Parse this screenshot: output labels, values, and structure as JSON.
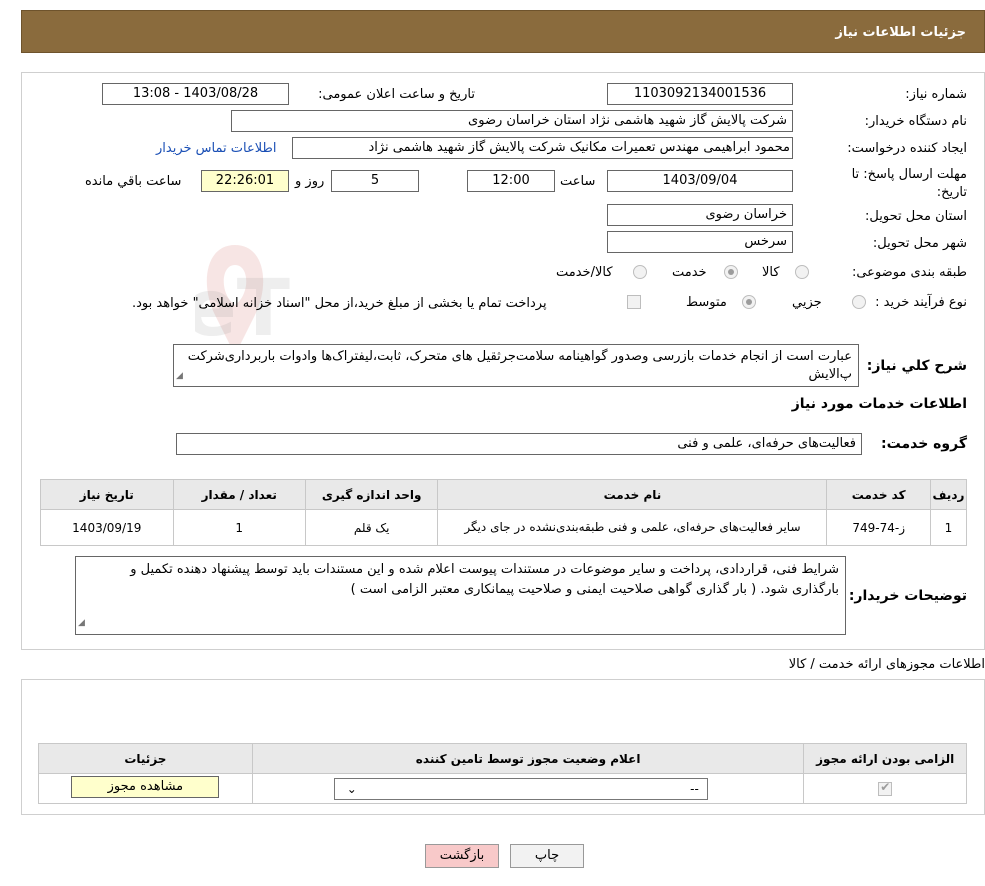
{
  "header": {
    "title": "جزئیات اطلاعات نیاز"
  },
  "form": {
    "need_number": {
      "label": "شماره نیاز:",
      "value": "1103092134001536"
    },
    "announce_datetime": {
      "label": "تاریخ و ساعت اعلان عمومی:",
      "value": "1403/08/28 - 13:08"
    },
    "buyer_org": {
      "label": "نام دستگاه خریدار:",
      "value": "شرکت پالایش گاز شهید هاشمی نژاد   استان خراسان رضوی"
    },
    "requester": {
      "label": "ایجاد کننده درخواست:",
      "value": "محمود ابراهیمی مهندس تعمیرات مکانیک شرکت پالایش گاز شهید هاشمی نژاد",
      "contact_link": "اطلاعات تماس خریدار"
    },
    "deadline": {
      "label": "مهلت ارسال پاسخ: تا تاریخ:",
      "date": "1403/09/04",
      "time_label": "ساعت",
      "time": "12:00",
      "days": "5",
      "days_label": "روز و",
      "remaining": "22:26:01",
      "remaining_label": "ساعت باقي مانده"
    },
    "delivery_province": {
      "label": "استان محل تحویل:",
      "value": "خراسان رضوی"
    },
    "delivery_city": {
      "label": "شهر محل تحویل:",
      "value": "سرخس"
    },
    "category": {
      "label": "طبقه بندی موضوعی:",
      "options": [
        {
          "label": "کالا",
          "checked": false
        },
        {
          "label": "خدمت",
          "checked": true
        },
        {
          "label": "کالا/خدمت",
          "checked": false
        }
      ]
    },
    "purchase_type": {
      "label": "نوع فرآیند خرید :",
      "options": [
        {
          "label": "جزیي",
          "checked": false
        },
        {
          "label": "متوسط",
          "checked": true
        }
      ],
      "note": "پرداخت تمام یا بخشی از مبلغ خرید،از محل \"اسناد خزانه اسلامی\" خواهد بود."
    },
    "description": {
      "label": "شرح کلي نياز:",
      "value": "عبارت است از انجام خدمات بازرسی وصدور گواهینامه سلامت‌جرثقیل های متحرک، ثابت،لیفتراک‌ها وادوات باربرداری‌شرکت پ‌الایش"
    }
  },
  "services_section": {
    "title": "اطلاعات خدمات مورد نیاز",
    "group_label": "گروه خدمت:",
    "group_value": "فعالیت‌های حرفه‌ای، علمی و فنی",
    "table": {
      "headers": [
        "ردیف",
        "کد خدمت",
        "نام خدمت",
        "واحد اندازه گیری",
        "تعداد / مقدار",
        "تاریخ نیاز"
      ],
      "rows": [
        [
          "1",
          "ز-74-749",
          "سایر فعالیت‌های حرفه‌ای، علمی و فنی طبقه‌بندی‌نشده در جای دیگر",
          "یک قلم",
          "1",
          "1403/09/19"
        ]
      ]
    },
    "buyer_notes_label": "توضیحات خریدار:",
    "buyer_notes": "شرایط فنی، قراردادی، پرداخت و سایر موضوعات در مستندات پیوست اعلام شده و این مستندات باید توسط پیشنهاد دهنده تکمیل و  بارگذاری شود. ( بار گذاری گواهی صلاحیت ایمنی و صلاحیت پیمانکاری معتبر الزامی است )"
  },
  "permits_section": {
    "title": "اطلاعات مجوزهای ارائه خدمت / کالا",
    "table": {
      "headers": [
        "الزامی بودن ارائه مجوز",
        "اعلام وضعیت مجوز توسط تامین کننده",
        "جزئیات"
      ],
      "row": {
        "required": true,
        "status_value": "--",
        "details_button": "مشاهده مجوز"
      }
    }
  },
  "buttons": {
    "print": "چاپ",
    "back": "بازگشت"
  },
  "watermark": {
    "text": "AriaTender.neT"
  }
}
